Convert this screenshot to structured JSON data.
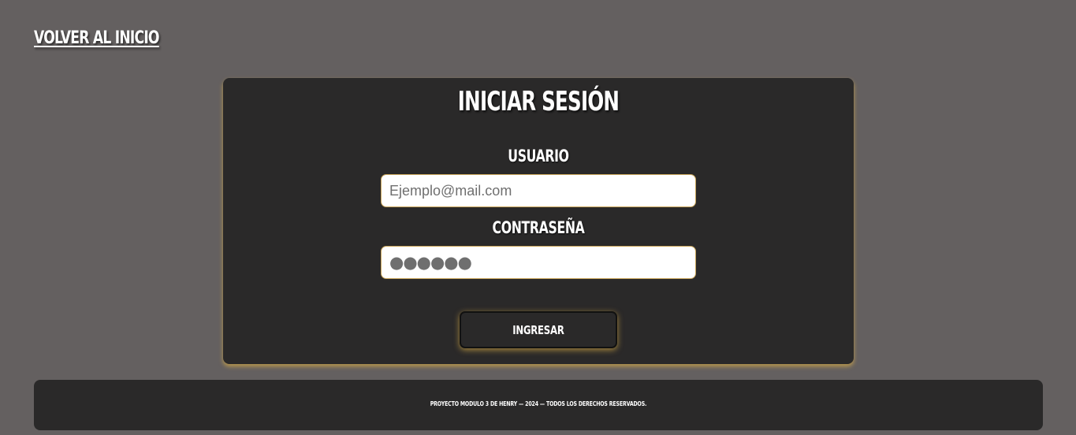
{
  "nav": {
    "back_link": "VOLVER AL INICIO"
  },
  "login": {
    "title": "INICIAR SESIÓN",
    "user_label": "USUARIO",
    "user_placeholder": "Ejemplo@mail.com",
    "password_label": "CONTRASEÑA",
    "password_placeholder": "●●●●●●",
    "submit_label": "INGRESAR"
  },
  "footer": {
    "text": "PROYECTO MODULO 3 DE HENRY — 2024 — TODOS LOS DERECHOS RESERVADOS."
  },
  "colors": {
    "page_background": "#646060",
    "panel_background": "#2a2929",
    "accent_glow": "#d6aa46",
    "text": "#ffffff"
  }
}
